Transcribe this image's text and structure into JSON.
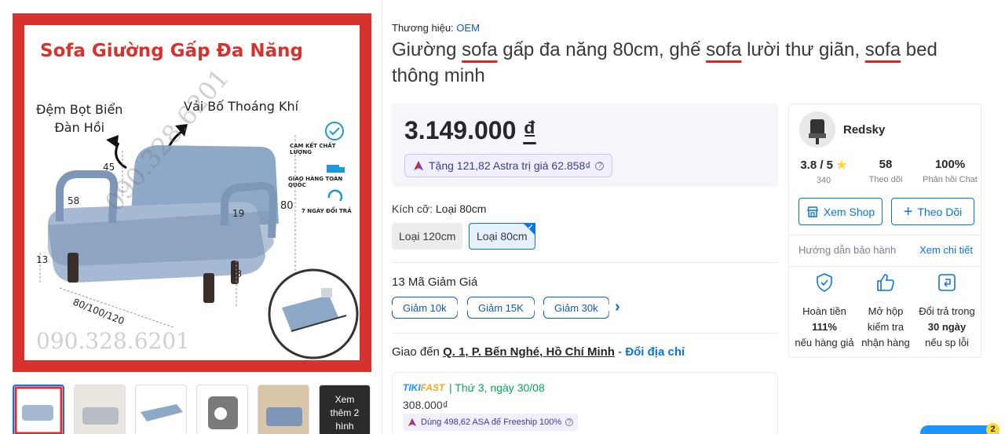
{
  "gallery": {
    "image": {
      "title": "Sofa Giường Gấp Đa Năng",
      "callout_foam": "Đệm Bọt Biển\nĐàn Hồi",
      "callout_fabric": "Vải Bố Thoáng Khí",
      "feature_quality": "CAM KẾT CHẤT LƯỢNG",
      "feature_delivery": "GIAO HÀNG TOÀN QUỐC",
      "feature_return": "7 NGÀY ĐỔI TRẢ",
      "dim_45": "45",
      "dim_58": "58",
      "dim_19": "19",
      "dim_80": "80",
      "dim_13": "13",
      "dim_33": "33",
      "dim_width": "80/100/120",
      "watermark": "090.328.6201"
    },
    "thumbs_more": "Xem\nthêm 2\nhình"
  },
  "product": {
    "brand_label": "Thương hiệu:",
    "brand_name": "OEM",
    "title_parts": [
      "Giường ",
      "sofa",
      " gấp đa năng 80cm, ghế ",
      "sofa",
      " lười thư giãn, ",
      "sofa",
      " bed thông minh"
    ],
    "price": "3.149.000",
    "currency": "₫",
    "astra_text": "Tặng 121,82 Astra trị giá 62.858₫"
  },
  "variant": {
    "label": "Kích cỡ:",
    "selected": "Loại 80cm",
    "options": [
      "Loại 120cm",
      "Loại 80cm"
    ]
  },
  "coupons": {
    "title": "13 Mã Giảm Giá",
    "items": [
      "Giảm 10k",
      "Giảm 15K",
      "Giảm 30k"
    ]
  },
  "delivery": {
    "prefix": "Giao đến",
    "address": "Q. 1, P. Bến Nghé, Hồ Chí Minh",
    "dash": " - ",
    "change": "Đổi địa chỉ",
    "tiki": "TIKI",
    "fast": "FAST",
    "date": "Thứ 3, ngày 30/08",
    "price": "308.000₫",
    "asa_text": "Dùng 498,62 ASA để Freeship 100%"
  },
  "seller": {
    "name": "Redsky",
    "rating": "3.8 / 5",
    "rating_count": "340",
    "followers": "58",
    "followers_label": "Theo dõi",
    "response": "100%",
    "response_label": "Phản hồi Chat",
    "view_shop": "Xem Shop",
    "follow": "Theo Dõi",
    "warranty": "Hướng dẫn bảo hành",
    "warranty_link": "Xem chi tiết",
    "policies": [
      {
        "l1": "Hoàn tiền",
        "l2": "111%",
        "l3": "nếu hàng giả"
      },
      {
        "l1": "Mở hộp",
        "l2": "kiểm tra",
        "l3": "nhận hàng"
      },
      {
        "l1": "Đổi trả trong",
        "l2": "30 ngày",
        "l3": "nếu sp lỗi"
      }
    ]
  },
  "chat": {
    "count": "2"
  },
  "colors": {
    "accent": "#0b74e5",
    "brand_red": "#d8322e",
    "green": "#00ab56"
  }
}
